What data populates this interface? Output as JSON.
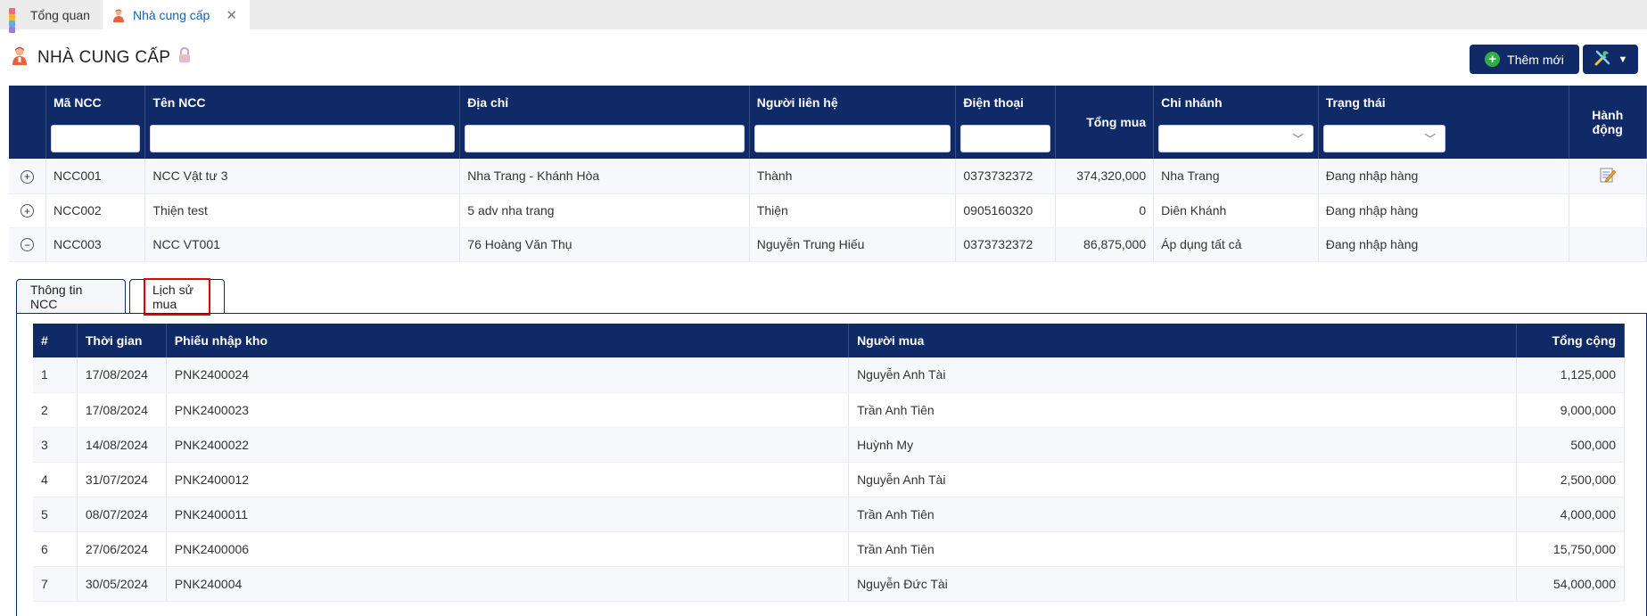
{
  "tabs": [
    {
      "label": "Tổng quan",
      "icon": "dashboard-grid-icon"
    },
    {
      "label": "Nhà cung cấp",
      "icon": "supplier-person-icon",
      "active": true
    }
  ],
  "page": {
    "title": "NHÀ CUNG CẤP",
    "add_button": "Thêm mới",
    "tools_icon": "tools-icon"
  },
  "supplier_table": {
    "columns": [
      "Mã NCC",
      "Tên NCC",
      "Địa chỉ",
      "Người liên hệ",
      "Điện thoại",
      "Tổng mua",
      "Chi nhánh",
      "Trạng thái",
      "Hành động"
    ],
    "rows": [
      {
        "code": "NCC001",
        "name": "NCC Vật tư 3",
        "address": "Nha Trang - Khánh Hòa",
        "contact": "Thành",
        "phone": "0373732372",
        "total": "374,320,000",
        "branch": "Nha Trang",
        "status": "Đang nhập hàng",
        "expanded": false
      },
      {
        "code": "NCC002",
        "name": "Thiện test",
        "address": "5 adv nha trang",
        "contact": "Thiện",
        "phone": "0905160320",
        "total": "0",
        "branch": "Diên Khánh",
        "status": "Đang nhập hàng",
        "expanded": false
      },
      {
        "code": "NCC003",
        "name": "NCC VT001",
        "address": "76 Hoàng Văn Thụ",
        "contact": "Nguyễn Trung Hiếu",
        "phone": "0373732372",
        "total": "86,875,000",
        "branch": "Áp dụng tất cả",
        "status": "Đang nhập hàng",
        "expanded": true
      }
    ]
  },
  "detail": {
    "tab_info": "Thông tin NCC",
    "tab_history": "Lịch sử mua",
    "history_columns": [
      "#",
      "Thời gian",
      "Phiếu nhập kho",
      "Người mua",
      "Tổng cộng"
    ],
    "history_rows": [
      {
        "no": "1",
        "date": "17/08/2024",
        "receipt": "PNK2400024",
        "buyer": "Nguyễn Anh Tài",
        "total": "1,125,000"
      },
      {
        "no": "2",
        "date": "17/08/2024",
        "receipt": "PNK2400023",
        "buyer": "Trần Anh Tiên",
        "total": "9,000,000"
      },
      {
        "no": "3",
        "date": "14/08/2024",
        "receipt": "PNK2400022",
        "buyer": "Huỳnh My",
        "total": "500,000"
      },
      {
        "no": "4",
        "date": "31/07/2024",
        "receipt": "PNK2400012",
        "buyer": "Nguyễn Anh Tài",
        "total": "2,500,000"
      },
      {
        "no": "5",
        "date": "08/07/2024",
        "receipt": "PNK2400011",
        "buyer": "Trần Anh Tiên",
        "total": "4,000,000"
      },
      {
        "no": "6",
        "date": "27/06/2024",
        "receipt": "PNK2400006",
        "buyer": "Trần Anh Tiên",
        "total": "15,750,000"
      },
      {
        "no": "7",
        "date": "30/05/2024",
        "receipt": "PNK240004",
        "buyer": "Nguyễn Đức Tài",
        "total": "54,000,000"
      }
    ]
  },
  "colors": {
    "navy": "#0f2a66",
    "green": "#2fae43",
    "highlight": "#e60000",
    "active_tab_text": "#0b63c4"
  }
}
